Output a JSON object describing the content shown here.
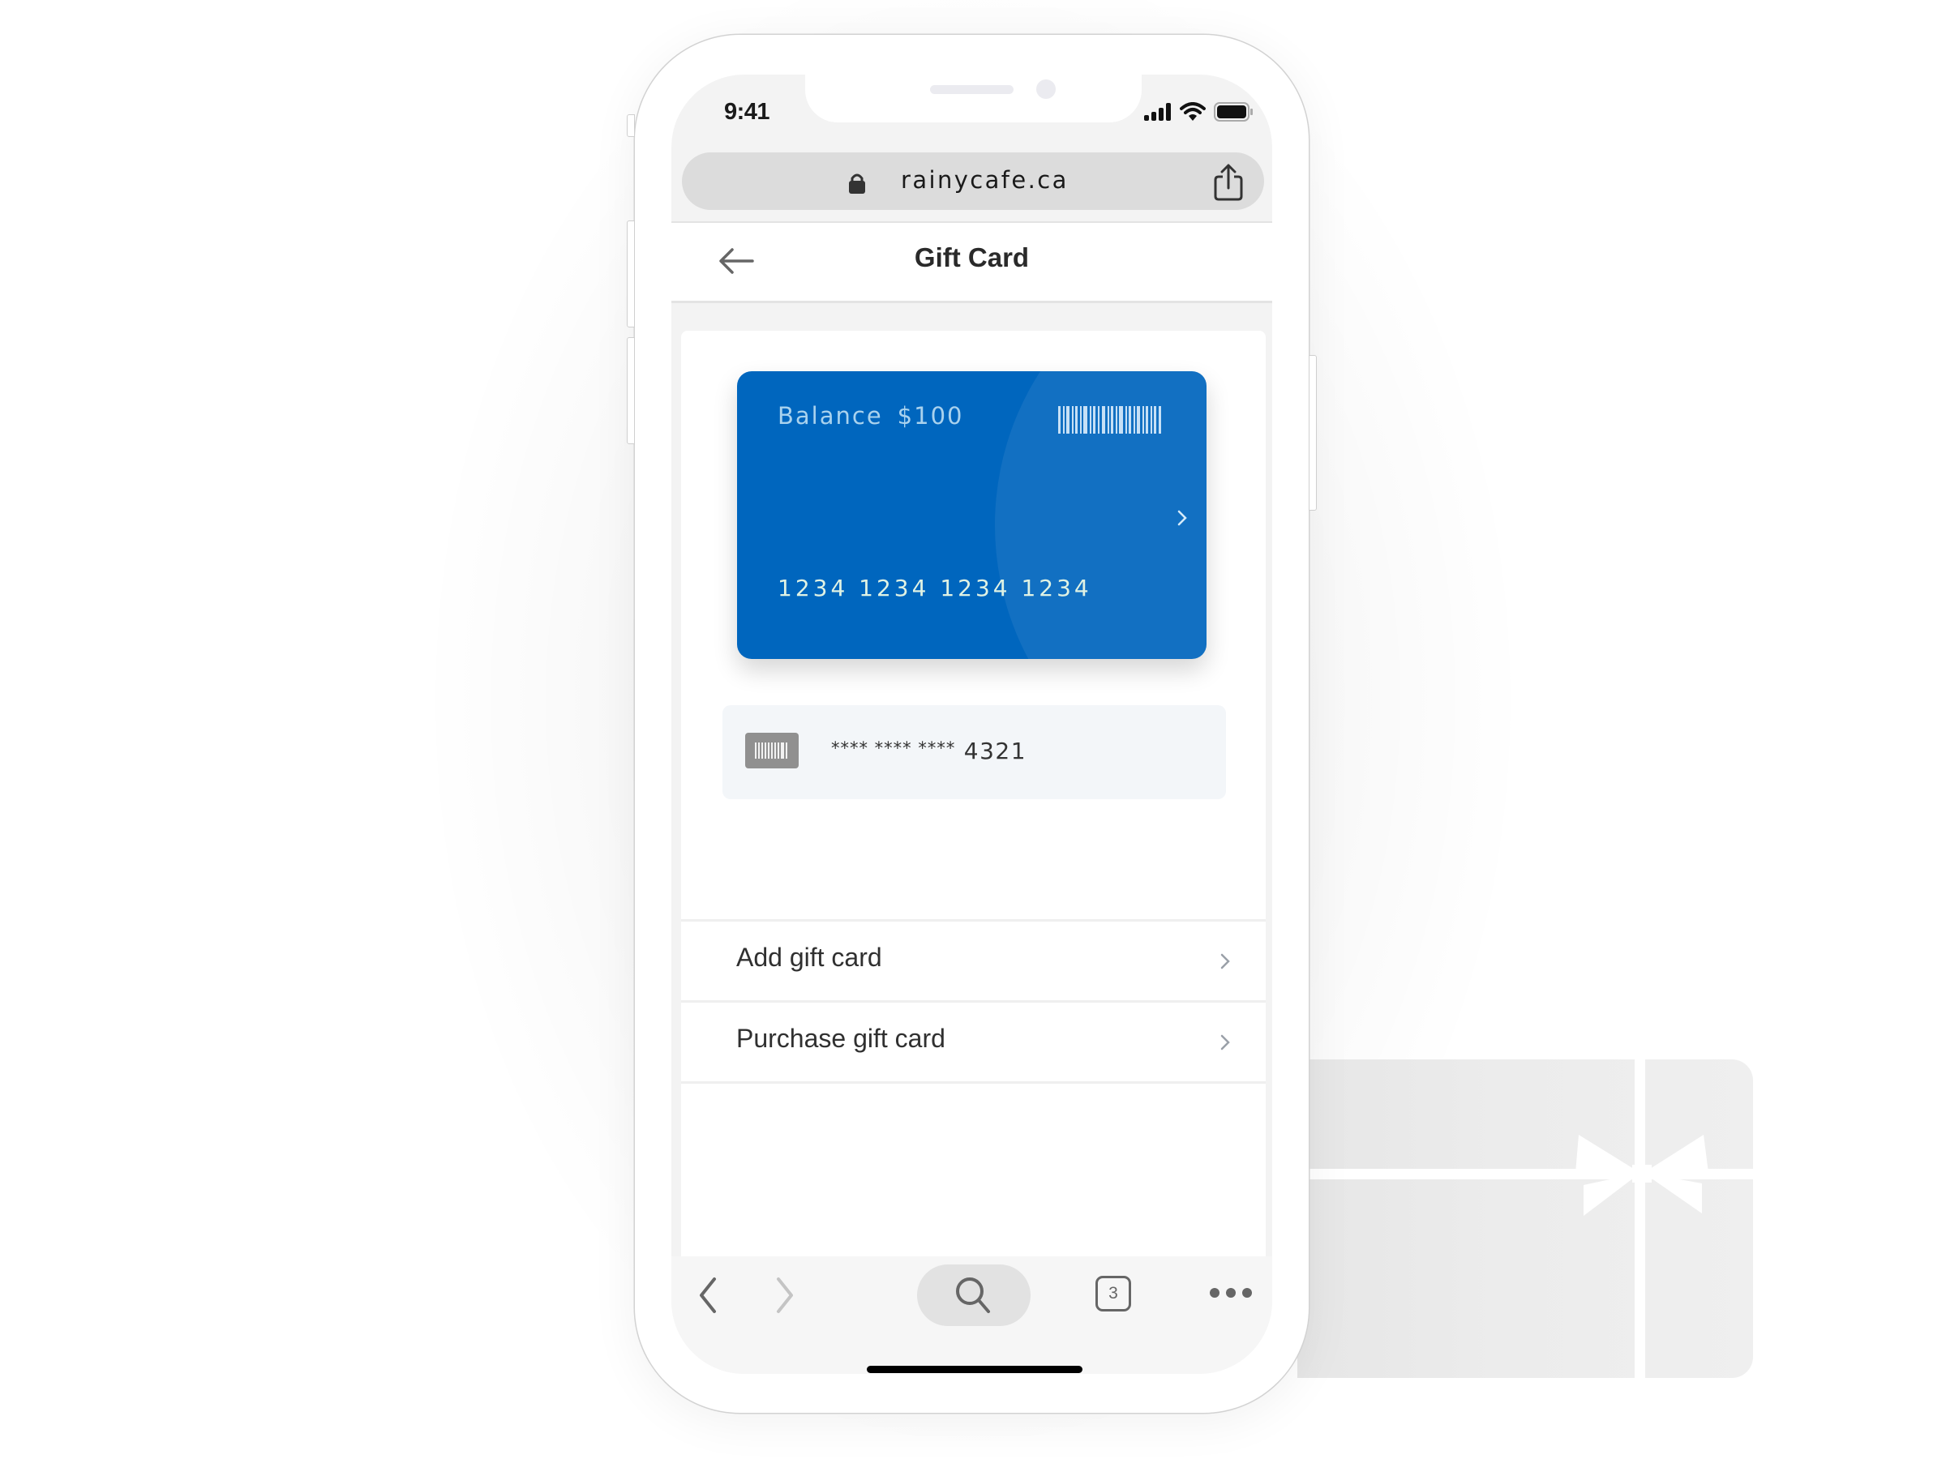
{
  "status_bar": {
    "time": "9:41",
    "icons": [
      "cellular-signal-icon",
      "wifi-icon",
      "battery-icon"
    ]
  },
  "browser": {
    "url": "rainycafe.ca",
    "secure_icon": "lock-icon",
    "share_icon": "share-icon",
    "toolbar": {
      "back_icon": "chevron-left-icon",
      "forward_icon": "chevron-right-icon",
      "search_icon": "search-icon",
      "tab_count": "3",
      "more_icon": "more-dots-icon"
    }
  },
  "page": {
    "title": "Gift Card",
    "back_icon": "arrow-left-icon"
  },
  "gift_card": {
    "balance_label": "Balance",
    "balance_amount": "$100",
    "card_number": "1234 1234 1234 1234",
    "barcode_icon": "barcode-icon",
    "chevron_icon": "chevron-right-icon",
    "colors": {
      "base": "#0066BE",
      "text": "#A9D2EE",
      "number": "#DFF2E4"
    }
  },
  "masked_card": {
    "masked_prefix": "**** **** ****",
    "last_four": "4321",
    "icon": "barcode-icon"
  },
  "menu": {
    "items": [
      {
        "label": "Add gift card",
        "icon": "chevron-right-icon"
      },
      {
        "label": "Purchase gift card",
        "icon": "chevron-right-icon"
      }
    ]
  },
  "decoration": {
    "icon": "gift-card-icon"
  }
}
